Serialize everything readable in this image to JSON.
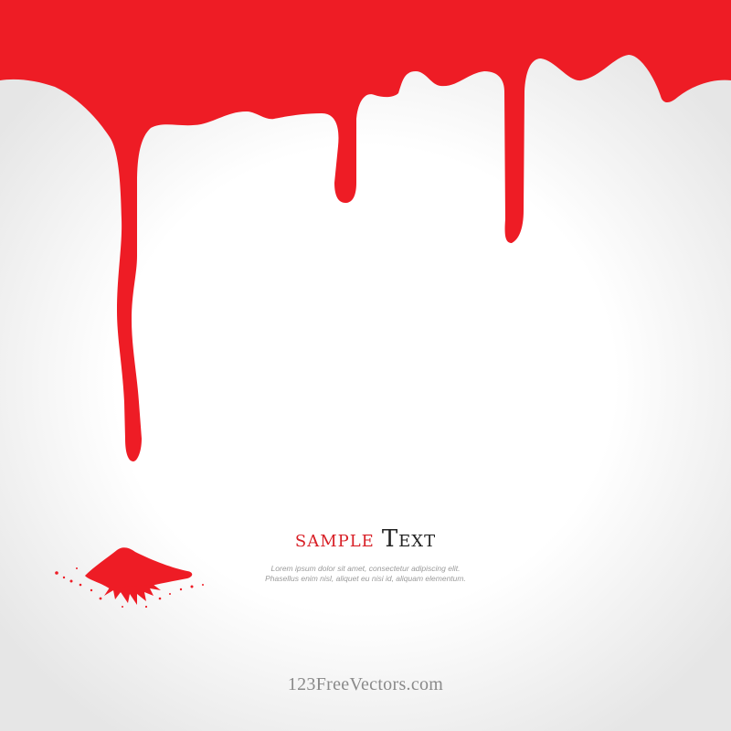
{
  "colors": {
    "paint": "#ee1c25",
    "headline_accent": "#d81f26",
    "headline_dark": "#222222",
    "body_text": "#9a9a9a",
    "watermark": "#8a8a8a"
  },
  "headline": {
    "word_1": "SAMPLE",
    "word_2": "Text"
  },
  "body_copy": {
    "line_1": "Lorem ipsum dolor sit amet, consectetur adipiscing elit.",
    "line_2": "Phasellus enim nisl, aliquet eu nisi id, aliquam elementum."
  },
  "watermark": "123FreeVectors.com"
}
